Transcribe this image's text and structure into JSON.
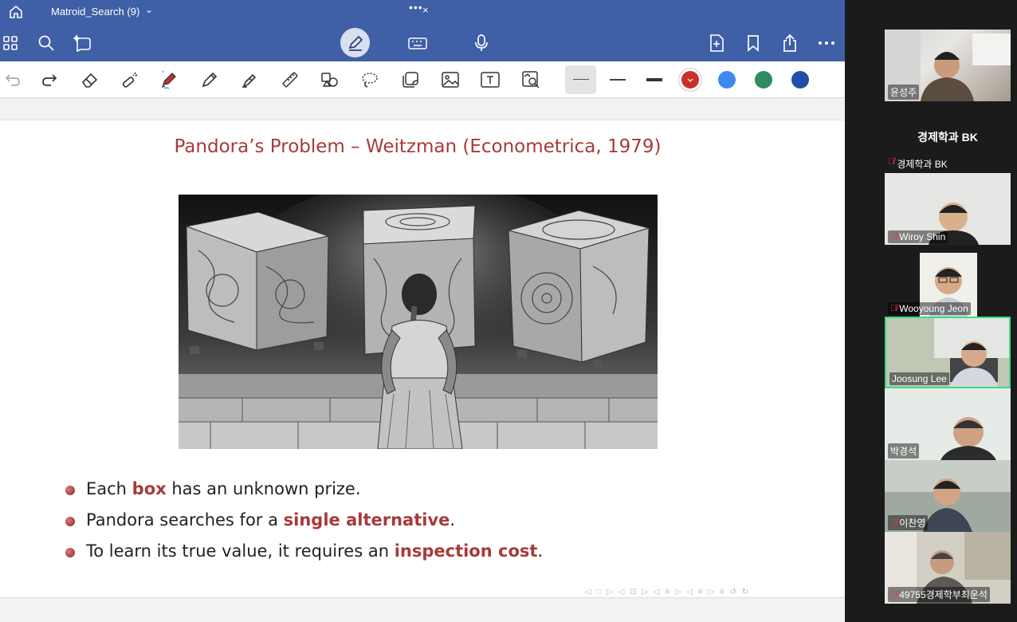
{
  "titlebar": {
    "doc_title": "Matroid_Search (9)",
    "caret": "⌄",
    "close": "×"
  },
  "toolbar": {
    "strokes": [
      "thin",
      "medium",
      "thick"
    ],
    "colors": [
      "#c9302c",
      "#3f88f0",
      "#2e8b62",
      "#1f4fa8"
    ]
  },
  "slide": {
    "title": "Pandora’s Problem – Weitzman (Econometrica, 1979)",
    "bullets": [
      {
        "pre": "Each ",
        "hl": "box",
        "post": " has an unknown prize."
      },
      {
        "pre": "Pandora searches for a ",
        "hl": "single alternative",
        "post": "."
      },
      {
        "pre": "To learn its true value, it requires an ",
        "hl": "inspection cost",
        "post": "."
      }
    ],
    "nav": "◁ □ ▷  ◁ ⊡ ▷  ◁ ≡ ▷  ◁ ≡ ▷   ≡   ↺ ↻"
  },
  "participants": {
    "bk_big": "경제학과 BK",
    "tiles": [
      {
        "name": "윤성주",
        "muted": false
      },
      {
        "name": "경제학과 BK",
        "muted": true
      },
      {
        "name": "Wiroy Shin",
        "muted": true
      },
      {
        "name": "Wooyoung Jeon",
        "muted": true
      },
      {
        "name": "Joosung Lee",
        "muted": false
      },
      {
        "name": "박경석",
        "muted": false
      },
      {
        "name": "이찬영",
        "muted": true
      },
      {
        "name": "49755경제학부최운석",
        "muted": true
      }
    ]
  }
}
